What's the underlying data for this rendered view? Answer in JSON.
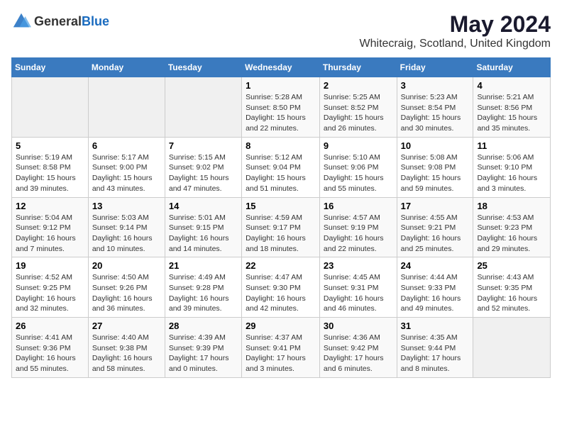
{
  "header": {
    "logo_general": "General",
    "logo_blue": "Blue",
    "month_year": "May 2024",
    "location": "Whitecraig, Scotland, United Kingdom"
  },
  "weekdays": [
    "Sunday",
    "Monday",
    "Tuesday",
    "Wednesday",
    "Thursday",
    "Friday",
    "Saturday"
  ],
  "weeks": [
    [
      {
        "day": "",
        "info": ""
      },
      {
        "day": "",
        "info": ""
      },
      {
        "day": "",
        "info": ""
      },
      {
        "day": "1",
        "info": "Sunrise: 5:28 AM\nSunset: 8:50 PM\nDaylight: 15 hours\nand 22 minutes."
      },
      {
        "day": "2",
        "info": "Sunrise: 5:25 AM\nSunset: 8:52 PM\nDaylight: 15 hours\nand 26 minutes."
      },
      {
        "day": "3",
        "info": "Sunrise: 5:23 AM\nSunset: 8:54 PM\nDaylight: 15 hours\nand 30 minutes."
      },
      {
        "day": "4",
        "info": "Sunrise: 5:21 AM\nSunset: 8:56 PM\nDaylight: 15 hours\nand 35 minutes."
      }
    ],
    [
      {
        "day": "5",
        "info": "Sunrise: 5:19 AM\nSunset: 8:58 PM\nDaylight: 15 hours\nand 39 minutes."
      },
      {
        "day": "6",
        "info": "Sunrise: 5:17 AM\nSunset: 9:00 PM\nDaylight: 15 hours\nand 43 minutes."
      },
      {
        "day": "7",
        "info": "Sunrise: 5:15 AM\nSunset: 9:02 PM\nDaylight: 15 hours\nand 47 minutes."
      },
      {
        "day": "8",
        "info": "Sunrise: 5:12 AM\nSunset: 9:04 PM\nDaylight: 15 hours\nand 51 minutes."
      },
      {
        "day": "9",
        "info": "Sunrise: 5:10 AM\nSunset: 9:06 PM\nDaylight: 15 hours\nand 55 minutes."
      },
      {
        "day": "10",
        "info": "Sunrise: 5:08 AM\nSunset: 9:08 PM\nDaylight: 15 hours\nand 59 minutes."
      },
      {
        "day": "11",
        "info": "Sunrise: 5:06 AM\nSunset: 9:10 PM\nDaylight: 16 hours\nand 3 minutes."
      }
    ],
    [
      {
        "day": "12",
        "info": "Sunrise: 5:04 AM\nSunset: 9:12 PM\nDaylight: 16 hours\nand 7 minutes."
      },
      {
        "day": "13",
        "info": "Sunrise: 5:03 AM\nSunset: 9:14 PM\nDaylight: 16 hours\nand 10 minutes."
      },
      {
        "day": "14",
        "info": "Sunrise: 5:01 AM\nSunset: 9:15 PM\nDaylight: 16 hours\nand 14 minutes."
      },
      {
        "day": "15",
        "info": "Sunrise: 4:59 AM\nSunset: 9:17 PM\nDaylight: 16 hours\nand 18 minutes."
      },
      {
        "day": "16",
        "info": "Sunrise: 4:57 AM\nSunset: 9:19 PM\nDaylight: 16 hours\nand 22 minutes."
      },
      {
        "day": "17",
        "info": "Sunrise: 4:55 AM\nSunset: 9:21 PM\nDaylight: 16 hours\nand 25 minutes."
      },
      {
        "day": "18",
        "info": "Sunrise: 4:53 AM\nSunset: 9:23 PM\nDaylight: 16 hours\nand 29 minutes."
      }
    ],
    [
      {
        "day": "19",
        "info": "Sunrise: 4:52 AM\nSunset: 9:25 PM\nDaylight: 16 hours\nand 32 minutes."
      },
      {
        "day": "20",
        "info": "Sunrise: 4:50 AM\nSunset: 9:26 PM\nDaylight: 16 hours\nand 36 minutes."
      },
      {
        "day": "21",
        "info": "Sunrise: 4:49 AM\nSunset: 9:28 PM\nDaylight: 16 hours\nand 39 minutes."
      },
      {
        "day": "22",
        "info": "Sunrise: 4:47 AM\nSunset: 9:30 PM\nDaylight: 16 hours\nand 42 minutes."
      },
      {
        "day": "23",
        "info": "Sunrise: 4:45 AM\nSunset: 9:31 PM\nDaylight: 16 hours\nand 46 minutes."
      },
      {
        "day": "24",
        "info": "Sunrise: 4:44 AM\nSunset: 9:33 PM\nDaylight: 16 hours\nand 49 minutes."
      },
      {
        "day": "25",
        "info": "Sunrise: 4:43 AM\nSunset: 9:35 PM\nDaylight: 16 hours\nand 52 minutes."
      }
    ],
    [
      {
        "day": "26",
        "info": "Sunrise: 4:41 AM\nSunset: 9:36 PM\nDaylight: 16 hours\nand 55 minutes."
      },
      {
        "day": "27",
        "info": "Sunrise: 4:40 AM\nSunset: 9:38 PM\nDaylight: 16 hours\nand 58 minutes."
      },
      {
        "day": "28",
        "info": "Sunrise: 4:39 AM\nSunset: 9:39 PM\nDaylight: 17 hours\nand 0 minutes."
      },
      {
        "day": "29",
        "info": "Sunrise: 4:37 AM\nSunset: 9:41 PM\nDaylight: 17 hours\nand 3 minutes."
      },
      {
        "day": "30",
        "info": "Sunrise: 4:36 AM\nSunset: 9:42 PM\nDaylight: 17 hours\nand 6 minutes."
      },
      {
        "day": "31",
        "info": "Sunrise: 4:35 AM\nSunset: 9:44 PM\nDaylight: 17 hours\nand 8 minutes."
      },
      {
        "day": "",
        "info": ""
      }
    ]
  ]
}
